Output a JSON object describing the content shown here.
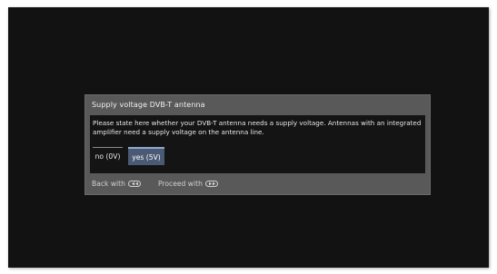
{
  "dialog": {
    "title": "Supply voltage DVB-T antenna",
    "text": "Please state here whether your DVB-T antenna needs a supply voltage. Antennas with an integrated amplifier need a supply voltage on the antenna line.",
    "options": [
      {
        "label": "no (0V)",
        "selected": false
      },
      {
        "label": "yes (5V)",
        "selected": true
      }
    ],
    "footer": {
      "back_label": "Back with",
      "back_icon": "rewind-key-icon",
      "proceed_label": "Proceed with",
      "proceed_icon": "fast-forward-key-icon"
    }
  },
  "colors": {
    "background": "#121212",
    "dialog": "#595959",
    "selected_option": "#4a5a74",
    "selected_accent": "#8fa9cf"
  }
}
